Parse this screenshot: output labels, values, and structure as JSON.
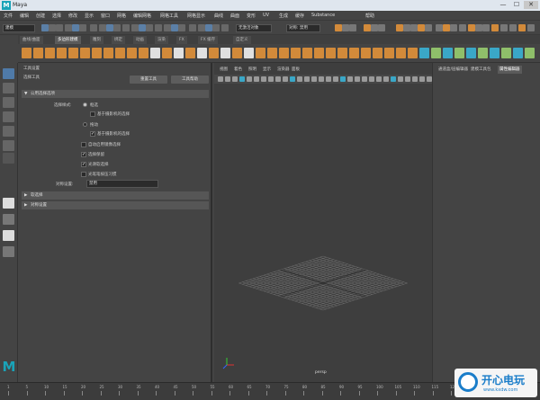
{
  "window": {
    "title": "Maya",
    "min": "—",
    "max": "☐",
    "close": "✕"
  },
  "menubar": [
    "文件",
    "编辑",
    "创建",
    "选择",
    "修改",
    "显示",
    "窗口",
    "网格",
    "编辑网格",
    "网格工具",
    "网格显示",
    "曲线",
    "曲面",
    "变形",
    "UV",
    "生成",
    "缓存",
    "Substance",
    "帮助"
  ],
  "statusline": {
    "mode": "建模",
    "live": "无激活对象",
    "symmetry": "对称: 禁用"
  },
  "shelf_tabs": [
    "曲线/曲面",
    "多边形建模",
    "雕刻",
    "绑定",
    "动画",
    "渲染",
    "FX",
    "FX 缓存",
    "自定义"
  ],
  "shelf_active": 1,
  "tool_settings": {
    "header": "工具设置",
    "subheader": "选择工具",
    "reset_button": "重置工具",
    "help_button": "工具帮助",
    "section_common": "公用选择选项",
    "selection_style_label": "选择样式:",
    "option_marquee": "框选",
    "option_marquee_camera": "基于摄影机的选择",
    "option_drag": "拖动",
    "option_drag_camera": "基于摄影机的选择",
    "option_auto": "自动启用镜像选择",
    "option_preserve": "选择保留",
    "option_soft": "光滑软选择",
    "option_space": "光笔笔按压习惯",
    "interaction_label": "对称设置:",
    "interaction_value": "禁用",
    "section_soft": "软选择",
    "section_symmetry": "对称设置"
  },
  "viewport": {
    "menu": [
      "视图",
      "着色",
      "照明",
      "显示",
      "渲染器",
      "面板"
    ],
    "camera_label": "persp"
  },
  "channel_box": {
    "tabs": [
      "通道盒/层编辑器",
      "建模工具包",
      "属性编辑器"
    ],
    "active_tab": 2
  },
  "timeline": {
    "ticks": [
      "1",
      "5",
      "10",
      "15",
      "20",
      "25",
      "30",
      "35",
      "40",
      "45",
      "50",
      "55",
      "60",
      "65",
      "70",
      "75",
      "80",
      "85",
      "90",
      "95",
      "100",
      "105",
      "110",
      "115",
      "120"
    ]
  },
  "watermark": {
    "text": "开心电玩",
    "sub": "www.kxdw.com"
  },
  "colors": {
    "accent": "#1aa3b8",
    "orange": "#d28a3a",
    "panel": "#444444",
    "viewport": "#3e3e3e"
  },
  "icons": {
    "logo": "maya-logo-icon"
  }
}
